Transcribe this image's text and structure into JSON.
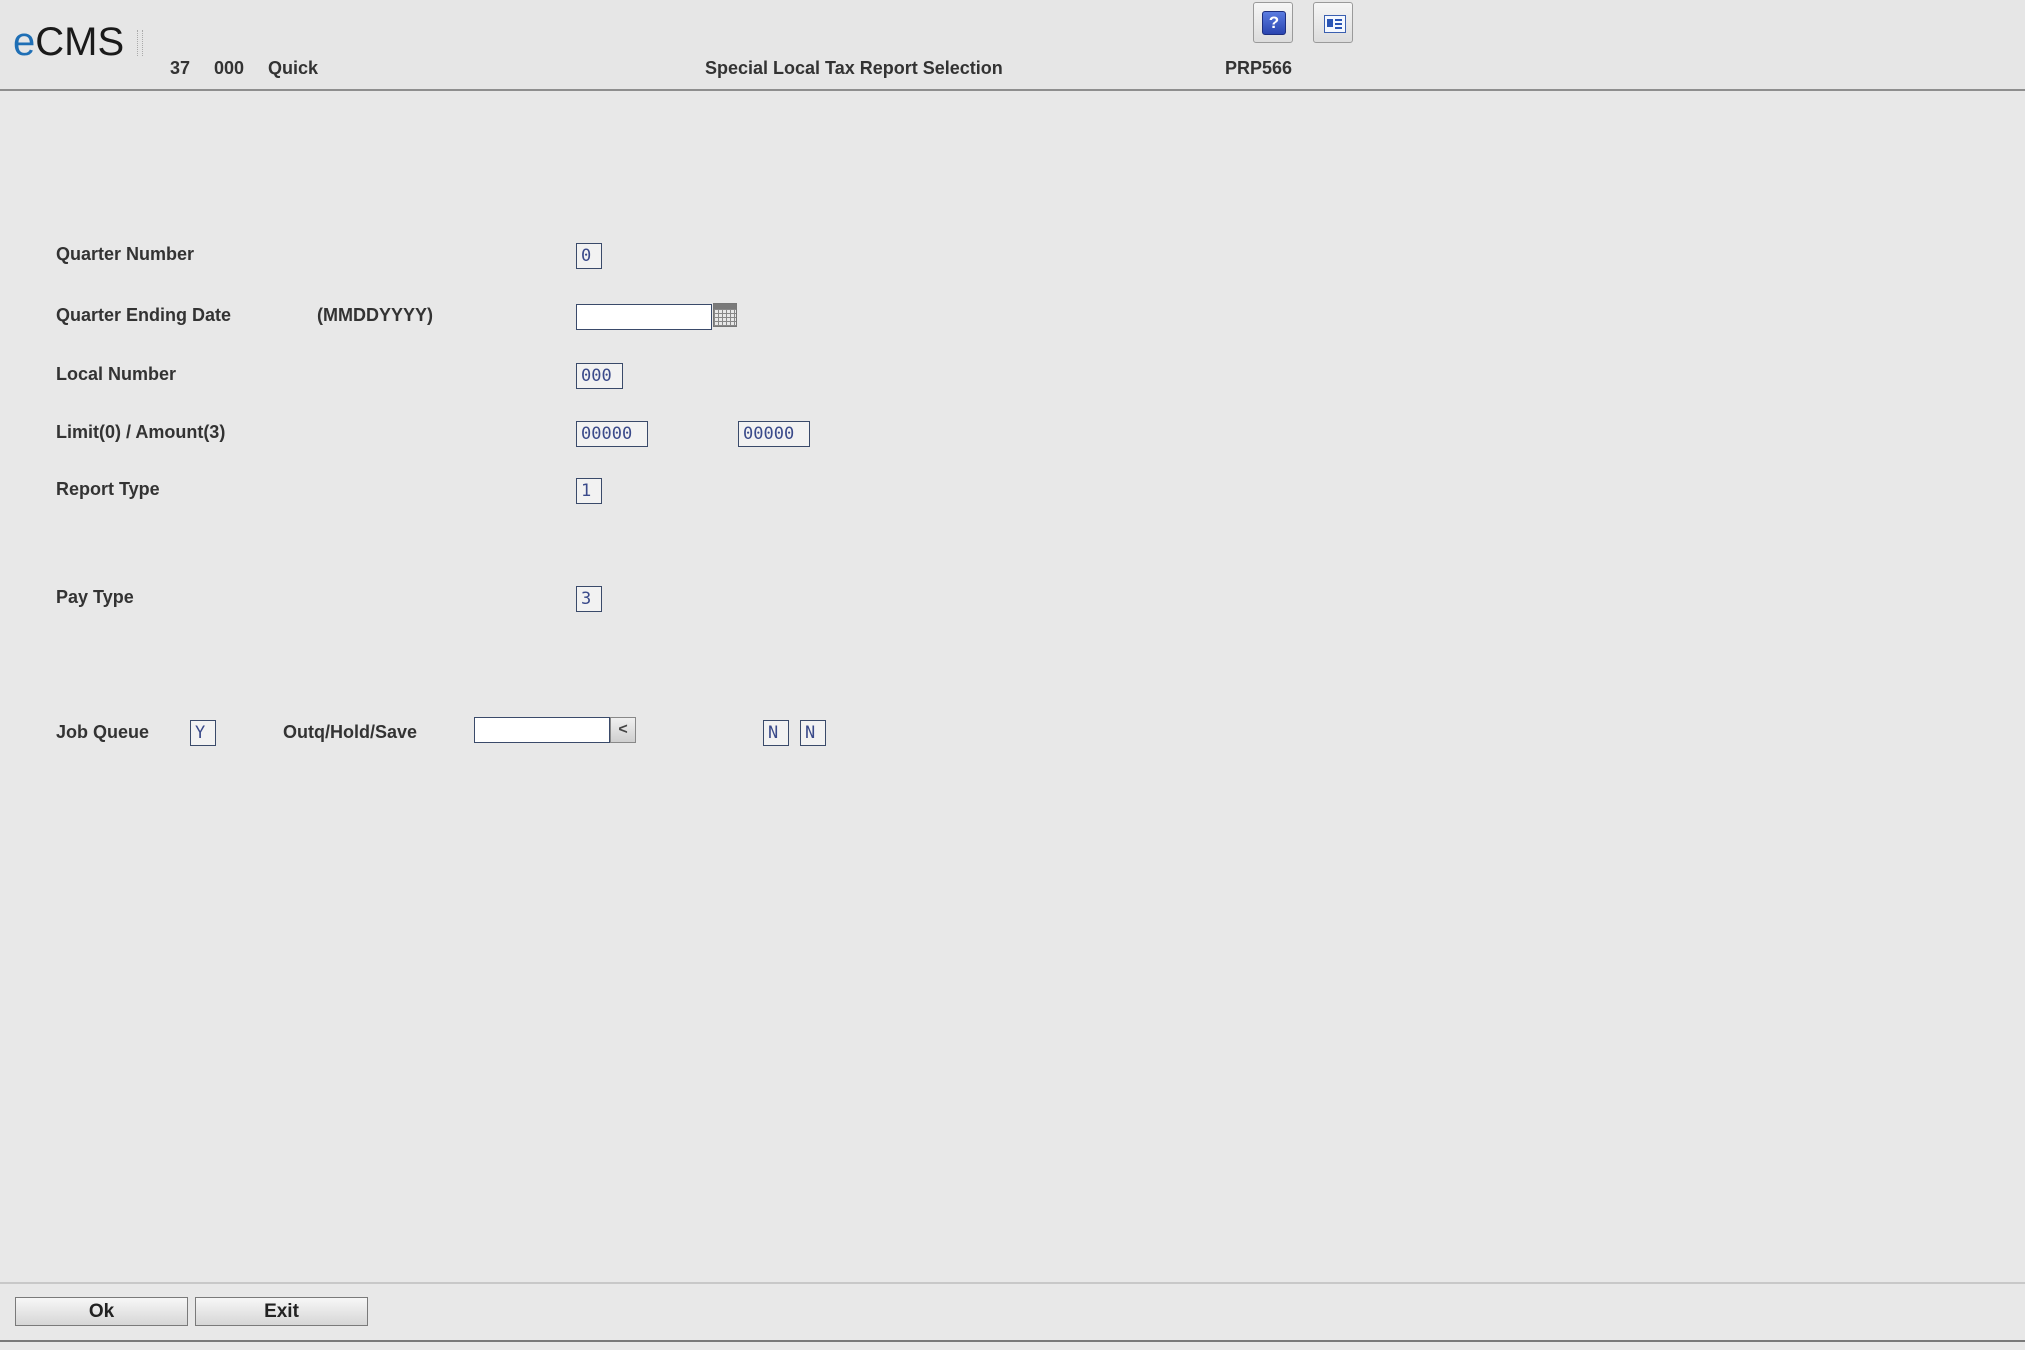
{
  "header": {
    "logo_e": "e",
    "logo_rest": "CMS",
    "company": "37",
    "division": "000",
    "mode": "Quick",
    "title": "Special Local Tax Report Selection",
    "program": "PRP566",
    "help_glyph": "?",
    "help_icon": "help-icon",
    "screen_icon": "screen-layout-icon"
  },
  "form": {
    "quarter_number": {
      "label": "Quarter Number",
      "value": "0"
    },
    "quarter_ending_date": {
      "label": "Quarter Ending Date",
      "format_hint": "(MMDDYYYY)",
      "value": ""
    },
    "local_number": {
      "label": "Local Number",
      "value": "000"
    },
    "limit_amount": {
      "label": "Limit(0) / Amount(3)",
      "limit_value": "00000",
      "amount_value": "00000"
    },
    "report_type": {
      "label": "Report Type",
      "value": "1"
    },
    "pay_type": {
      "label": "Pay Type",
      "value": "3"
    }
  },
  "job": {
    "job_queue_label": "Job Queue",
    "job_queue_value": "Y",
    "outq_label": "Outq/Hold/Save",
    "outq_value": "",
    "outq_arrow": "<",
    "hold_value": "N",
    "save_value": "N"
  },
  "footer": {
    "ok_label": "Ok",
    "exit_label": "Exit"
  }
}
